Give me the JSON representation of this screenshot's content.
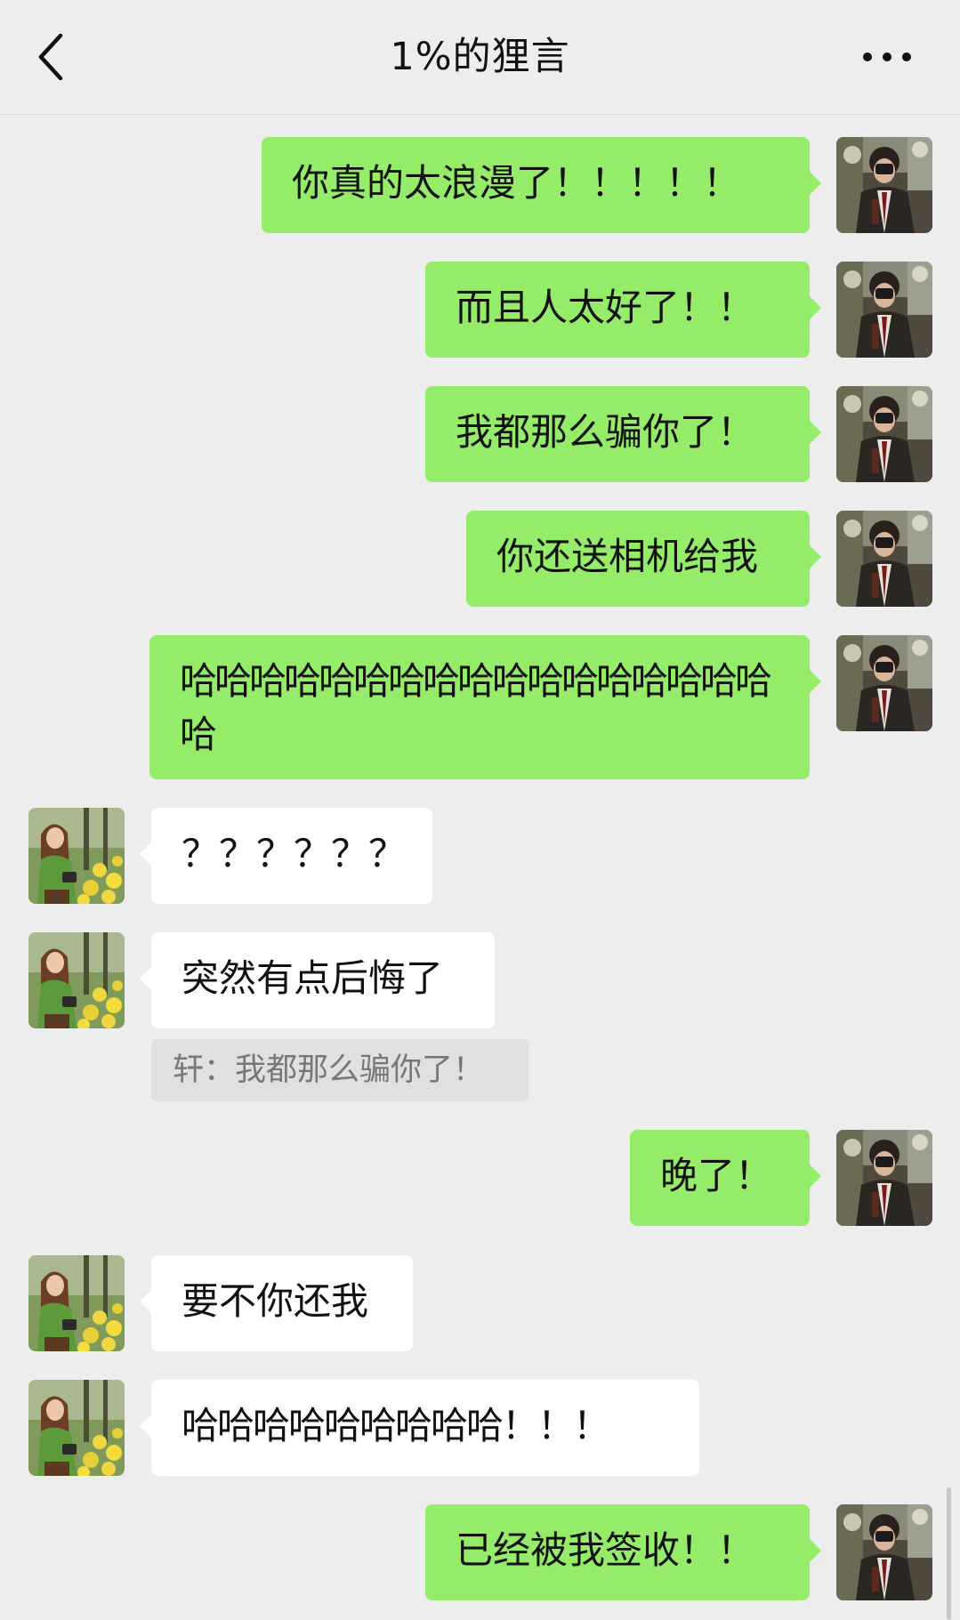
{
  "header": {
    "title": "1%的狸言"
  },
  "messages": [
    {
      "from": "me",
      "text": "你真的太浪漫了！！！！！"
    },
    {
      "from": "me",
      "text": "而且人太好了！！"
    },
    {
      "from": "me",
      "text": "我都那么骗你了！"
    },
    {
      "from": "me",
      "text": "你还送相机给我"
    },
    {
      "from": "me",
      "text": "哈哈哈哈哈哈哈哈哈哈哈哈哈哈哈哈哈哈"
    },
    {
      "from": "them",
      "text": "？？？？？？"
    },
    {
      "from": "them",
      "text": "突然有点后悔了",
      "quote": "轩：我都那么骗你了！"
    },
    {
      "from": "me",
      "text": "晚了！"
    },
    {
      "from": "them",
      "text": "要不你还我"
    },
    {
      "from": "them",
      "text": "哈哈哈哈哈哈哈哈哈！！！"
    },
    {
      "from": "me",
      "text": "已经被我签收！！"
    }
  ],
  "colors": {
    "me_bubble": "#95ec69",
    "them_bubble": "#ffffff",
    "background": "#ededed"
  }
}
